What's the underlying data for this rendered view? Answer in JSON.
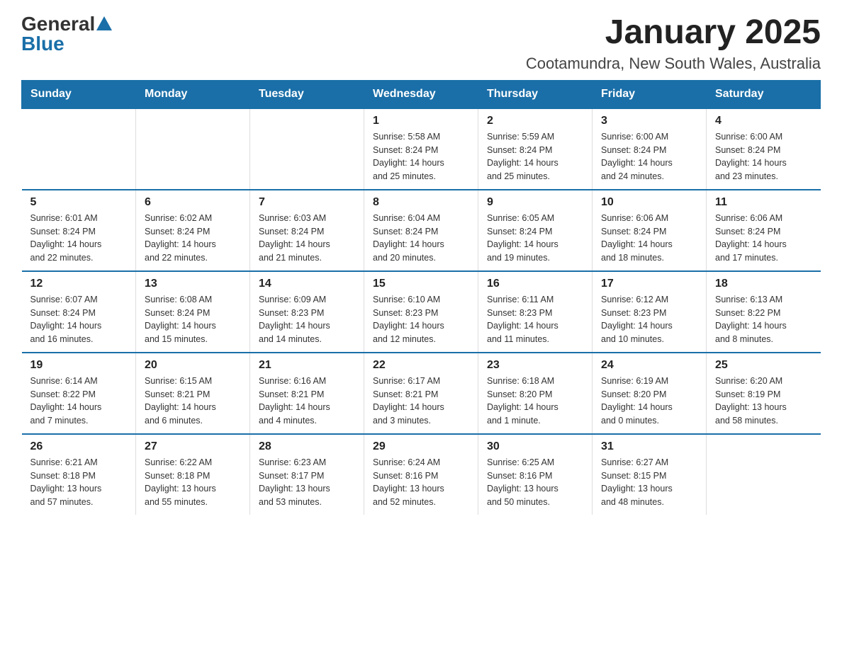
{
  "logo": {
    "general": "General",
    "blue": "Blue"
  },
  "header": {
    "title": "January 2025",
    "subtitle": "Cootamundra, New South Wales, Australia"
  },
  "days_of_week": [
    "Sunday",
    "Monday",
    "Tuesday",
    "Wednesday",
    "Thursday",
    "Friday",
    "Saturday"
  ],
  "weeks": [
    [
      {
        "day": "",
        "info": ""
      },
      {
        "day": "",
        "info": ""
      },
      {
        "day": "",
        "info": ""
      },
      {
        "day": "1",
        "info": "Sunrise: 5:58 AM\nSunset: 8:24 PM\nDaylight: 14 hours\nand 25 minutes."
      },
      {
        "day": "2",
        "info": "Sunrise: 5:59 AM\nSunset: 8:24 PM\nDaylight: 14 hours\nand 25 minutes."
      },
      {
        "day": "3",
        "info": "Sunrise: 6:00 AM\nSunset: 8:24 PM\nDaylight: 14 hours\nand 24 minutes."
      },
      {
        "day": "4",
        "info": "Sunrise: 6:00 AM\nSunset: 8:24 PM\nDaylight: 14 hours\nand 23 minutes."
      }
    ],
    [
      {
        "day": "5",
        "info": "Sunrise: 6:01 AM\nSunset: 8:24 PM\nDaylight: 14 hours\nand 22 minutes."
      },
      {
        "day": "6",
        "info": "Sunrise: 6:02 AM\nSunset: 8:24 PM\nDaylight: 14 hours\nand 22 minutes."
      },
      {
        "day": "7",
        "info": "Sunrise: 6:03 AM\nSunset: 8:24 PM\nDaylight: 14 hours\nand 21 minutes."
      },
      {
        "day": "8",
        "info": "Sunrise: 6:04 AM\nSunset: 8:24 PM\nDaylight: 14 hours\nand 20 minutes."
      },
      {
        "day": "9",
        "info": "Sunrise: 6:05 AM\nSunset: 8:24 PM\nDaylight: 14 hours\nand 19 minutes."
      },
      {
        "day": "10",
        "info": "Sunrise: 6:06 AM\nSunset: 8:24 PM\nDaylight: 14 hours\nand 18 minutes."
      },
      {
        "day": "11",
        "info": "Sunrise: 6:06 AM\nSunset: 8:24 PM\nDaylight: 14 hours\nand 17 minutes."
      }
    ],
    [
      {
        "day": "12",
        "info": "Sunrise: 6:07 AM\nSunset: 8:24 PM\nDaylight: 14 hours\nand 16 minutes."
      },
      {
        "day": "13",
        "info": "Sunrise: 6:08 AM\nSunset: 8:24 PM\nDaylight: 14 hours\nand 15 minutes."
      },
      {
        "day": "14",
        "info": "Sunrise: 6:09 AM\nSunset: 8:23 PM\nDaylight: 14 hours\nand 14 minutes."
      },
      {
        "day": "15",
        "info": "Sunrise: 6:10 AM\nSunset: 8:23 PM\nDaylight: 14 hours\nand 12 minutes."
      },
      {
        "day": "16",
        "info": "Sunrise: 6:11 AM\nSunset: 8:23 PM\nDaylight: 14 hours\nand 11 minutes."
      },
      {
        "day": "17",
        "info": "Sunrise: 6:12 AM\nSunset: 8:23 PM\nDaylight: 14 hours\nand 10 minutes."
      },
      {
        "day": "18",
        "info": "Sunrise: 6:13 AM\nSunset: 8:22 PM\nDaylight: 14 hours\nand 8 minutes."
      }
    ],
    [
      {
        "day": "19",
        "info": "Sunrise: 6:14 AM\nSunset: 8:22 PM\nDaylight: 14 hours\nand 7 minutes."
      },
      {
        "day": "20",
        "info": "Sunrise: 6:15 AM\nSunset: 8:21 PM\nDaylight: 14 hours\nand 6 minutes."
      },
      {
        "day": "21",
        "info": "Sunrise: 6:16 AM\nSunset: 8:21 PM\nDaylight: 14 hours\nand 4 minutes."
      },
      {
        "day": "22",
        "info": "Sunrise: 6:17 AM\nSunset: 8:21 PM\nDaylight: 14 hours\nand 3 minutes."
      },
      {
        "day": "23",
        "info": "Sunrise: 6:18 AM\nSunset: 8:20 PM\nDaylight: 14 hours\nand 1 minute."
      },
      {
        "day": "24",
        "info": "Sunrise: 6:19 AM\nSunset: 8:20 PM\nDaylight: 14 hours\nand 0 minutes."
      },
      {
        "day": "25",
        "info": "Sunrise: 6:20 AM\nSunset: 8:19 PM\nDaylight: 13 hours\nand 58 minutes."
      }
    ],
    [
      {
        "day": "26",
        "info": "Sunrise: 6:21 AM\nSunset: 8:18 PM\nDaylight: 13 hours\nand 57 minutes."
      },
      {
        "day": "27",
        "info": "Sunrise: 6:22 AM\nSunset: 8:18 PM\nDaylight: 13 hours\nand 55 minutes."
      },
      {
        "day": "28",
        "info": "Sunrise: 6:23 AM\nSunset: 8:17 PM\nDaylight: 13 hours\nand 53 minutes."
      },
      {
        "day": "29",
        "info": "Sunrise: 6:24 AM\nSunset: 8:16 PM\nDaylight: 13 hours\nand 52 minutes."
      },
      {
        "day": "30",
        "info": "Sunrise: 6:25 AM\nSunset: 8:16 PM\nDaylight: 13 hours\nand 50 minutes."
      },
      {
        "day": "31",
        "info": "Sunrise: 6:27 AM\nSunset: 8:15 PM\nDaylight: 13 hours\nand 48 minutes."
      },
      {
        "day": "",
        "info": ""
      }
    ]
  ]
}
